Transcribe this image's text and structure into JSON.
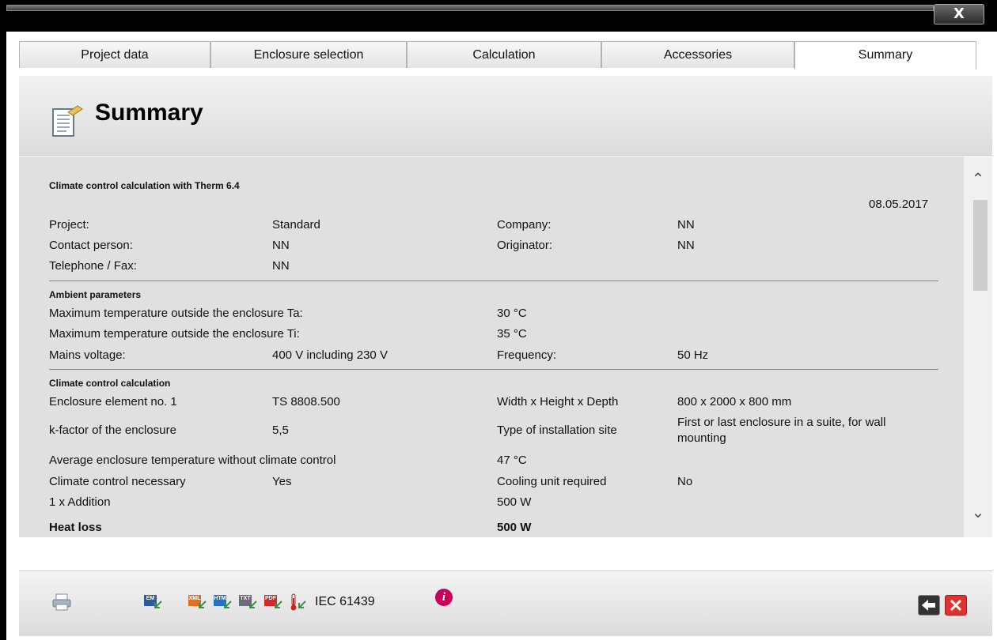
{
  "window": {
    "close_label": "X"
  },
  "tabs": [
    {
      "label": "Project data"
    },
    {
      "label": "Enclosure selection"
    },
    {
      "label": "Calculation"
    },
    {
      "label": "Accessories"
    },
    {
      "label": "Summary"
    }
  ],
  "header": {
    "title": "Summary",
    "icon": "clipboard-doc-icon"
  },
  "report": {
    "heading": "Climate control calculation with Therm 6.4",
    "date": "08.05.2017",
    "project": {
      "project_label": "Project:",
      "project_value": "Standard",
      "company_label": "Company:",
      "company_value": "NN",
      "contact_label": "Contact person:",
      "contact_value": "NN",
      "originator_label": "Originator:",
      "originator_value": "NN",
      "phone_label": "Telephone / Fax:",
      "phone_value": "NN"
    },
    "ambient": {
      "section_title": "Ambient parameters",
      "ta_label": "Maximum temperature outside the enclosure Ta:",
      "ta_value": "30 °C",
      "ti_label": "Maximum temperature outside the enclosure Ti:",
      "ti_value": "35 °C",
      "mains_label": "Mains voltage:",
      "mains_value": "400 V including 230 V",
      "freq_label": "Frequency:",
      "freq_value": "50 Hz"
    },
    "climate": {
      "section_title": "Climate control calculation",
      "element_label": "Enclosure element no. 1",
      "element_value": "TS 8808.500",
      "dims_label": "Width x Height x Depth",
      "dims_value": "800 x 2000 x 800 mm",
      "kfactor_label": "k-factor of the enclosure",
      "kfactor_value": "5,5",
      "site_label": "Type of installation site",
      "site_value_line1": "First or last enclosure in a suite, for wall",
      "site_value_line2": "mounting",
      "avg_label": "Average enclosure temperature without climate control",
      "avg_value": "47 °C",
      "necessary_label": "Climate control necessary",
      "necessary_value": "Yes",
      "cooling_label": "Cooling unit required",
      "cooling_value": "No",
      "addition_label": "1 x Addition",
      "addition_value": "500 W",
      "heatloss_label": "Heat loss",
      "heatloss_value": "500 W"
    }
  },
  "footer": {
    "standard_label": "IEC 61439",
    "icons": [
      "print-icon",
      "export-em-icon",
      "export-xml-icon",
      "export-htm-icon",
      "export-txt-icon",
      "export-pdf-icon",
      "export-thermometer-icon",
      "info-icon",
      "back-icon",
      "cancel-icon"
    ],
    "export_tags": {
      "em": "EM",
      "xml": "XML",
      "htm": "HTM",
      "txt": "TXT",
      "pdf": "PDF"
    },
    "info_glyph": "i"
  },
  "colors": {
    "accent": "#c8005a",
    "cancel": "#e03030",
    "back": "#333333"
  }
}
